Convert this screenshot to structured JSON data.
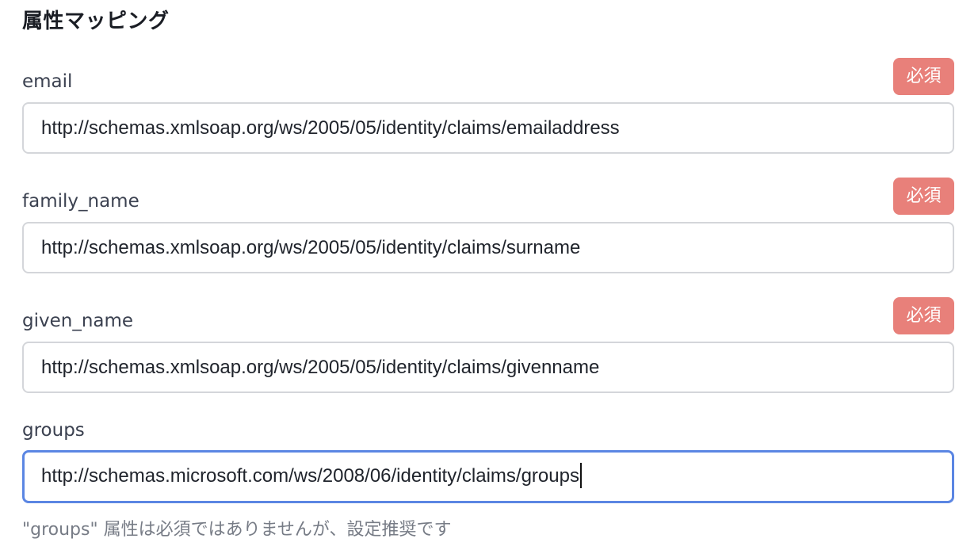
{
  "section": {
    "title": "属性マッピング"
  },
  "fields": [
    {
      "label": "email",
      "badge": "必須",
      "value": "http://schemas.xmlsoap.org/ws/2005/05/identity/claims/emailaddress"
    },
    {
      "label": "family_name",
      "badge": "必須",
      "value": "http://schemas.xmlsoap.org/ws/2005/05/identity/claims/surname"
    },
    {
      "label": "given_name",
      "badge": "必須",
      "value": "http://schemas.xmlsoap.org/ws/2005/05/identity/claims/givenname"
    },
    {
      "label": "groups",
      "value": "http://schemas.microsoft.com/ws/2008/06/identity/claims/groups",
      "help": "\"groups\" 属性は必須ではありませんが、設定推奨です"
    }
  ],
  "colors": {
    "badge": "#e8807a",
    "focus_border": "#5b86e3",
    "input_border": "#d4d6da"
  }
}
